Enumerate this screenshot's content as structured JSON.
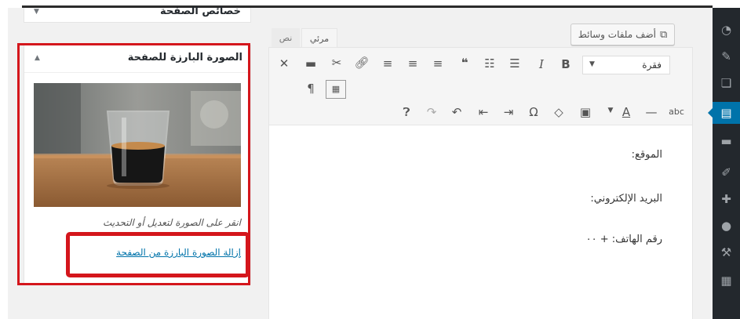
{
  "meta": {
    "page_attributes_title": "خصائص الصفحة",
    "featured": {
      "title": "الصورة البارزة للصفحة",
      "caption": "انقر على الصورة لتعديل أو التحديث",
      "remove_link": "إزالة الصورة البارزة من الصفحة"
    }
  },
  "editor": {
    "add_media_label": "أضف ملفات وسائط",
    "tabs": {
      "visual": "مرئي",
      "text": "نص"
    },
    "format_select": "فقرة",
    "content_lines": [
      "الموقع:",
      "البريد الإلكتروني:",
      "رقم الهاتف: + ٠٠"
    ]
  },
  "icons": {
    "admin_menu": [
      "dashboard-icon",
      "pin-icon",
      "media-icon",
      "pages-icon",
      "comments-icon",
      "appearance-icon",
      "plugins-icon",
      "users-icon",
      "tools-icon",
      "settings-icon"
    ]
  },
  "colors": {
    "admin_bg": "#23282d",
    "accent": "#0073aa",
    "highlight_red": "#d4161c"
  }
}
